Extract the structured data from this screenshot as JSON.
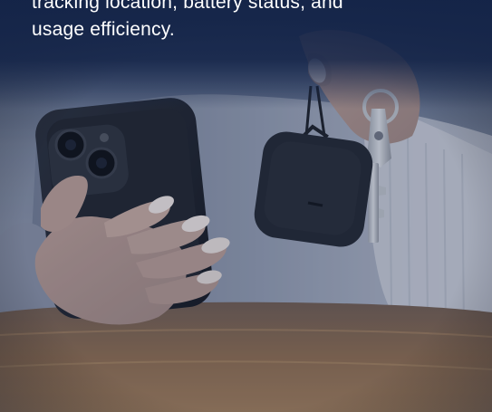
{
  "caption": {
    "line1": "tracking location, battery status, and",
    "line2": "usage efficiency."
  },
  "colors": {
    "overlay": "#142448",
    "text": "#ffffff",
    "wall": "#8e96a8",
    "table": "#8a6a4e",
    "phone": "#1c1f26",
    "tracker": "#222630",
    "key": "#c9ccd2",
    "skin": "#c9a99a",
    "nails": "#e7dfdc"
  },
  "image": {
    "subject": "hand-holding-smartphone-and-key-tracker"
  }
}
